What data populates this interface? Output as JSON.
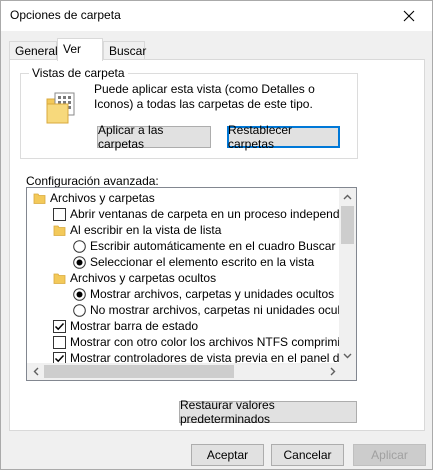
{
  "window": {
    "title": "Opciones de carpeta"
  },
  "tabs": [
    {
      "label": "General"
    },
    {
      "label": "Ver"
    },
    {
      "label": "Buscar"
    }
  ],
  "folder_views": {
    "group_label": "Vistas de carpeta",
    "description": "Puede aplicar esta vista (como Detalles o Iconos) a todas las carpetas de este tipo.",
    "apply_button": "Aplicar a las carpetas",
    "reset_button": "Restablecer carpetas"
  },
  "advanced": {
    "label": "Configuración avanzada:",
    "items": [
      {
        "type": "folder",
        "level": 0,
        "label": "Archivos y carpetas"
      },
      {
        "type": "checkbox",
        "level": 1,
        "label": "Abrir ventanas de carpeta  en un proceso independiente",
        "checked": false
      },
      {
        "type": "folder",
        "level": 1,
        "label": "Al escribir en la vista de lista"
      },
      {
        "type": "radio",
        "level": 2,
        "label": "Escribir automáticamente en el cuadro Buscar",
        "checked": false
      },
      {
        "type": "radio",
        "level": 2,
        "label": "Seleccionar el elemento escrito en la vista",
        "checked": true
      },
      {
        "type": "folder",
        "level": 1,
        "label": "Archivos y carpetas ocultos"
      },
      {
        "type": "radio",
        "level": 2,
        "label": "Mostrar archivos, carpetas y unidades ocultos",
        "checked": true
      },
      {
        "type": "radio",
        "level": 2,
        "label": "No mostrar archivos, carpetas ni unidades ocultos",
        "checked": false
      },
      {
        "type": "checkbox",
        "level": 1,
        "label": "Mostrar barra de estado",
        "checked": true
      },
      {
        "type": "checkbox",
        "level": 1,
        "label": "Mostrar con otro color los archivos NTFS comprimidos o c",
        "checked": false
      },
      {
        "type": "checkbox",
        "level": 1,
        "label": "Mostrar controladores de vista previa en el panel de vista",
        "checked": true
      }
    ]
  },
  "restore_button": "Restaurar valores predeterminados",
  "footer": {
    "ok": "Aceptar",
    "cancel": "Cancelar",
    "apply": "Aplicar"
  },
  "colors": {
    "folder": "#f3c95a",
    "accent": "#0078d7"
  },
  "icons": {
    "close": "close-icon",
    "folder": "folder-icon",
    "folder_view": "folder-view-icon"
  }
}
